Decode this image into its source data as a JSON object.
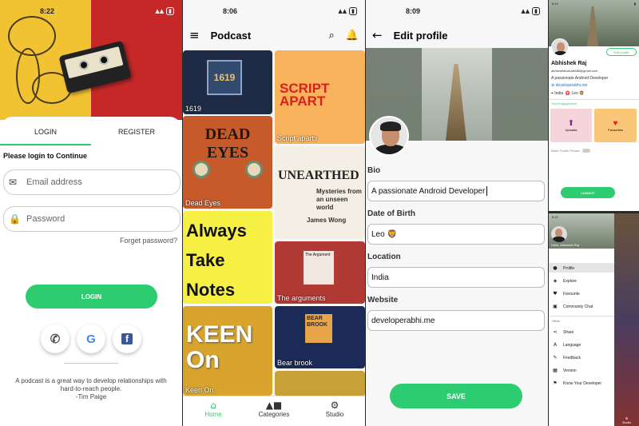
{
  "login": {
    "status_time": "8:22",
    "tab_login": "LOGIN",
    "tab_register": "REGISTER",
    "prompt": "Please login to Continue",
    "email_placeholder": "Email address",
    "password_placeholder": "Password",
    "forgot": "Forget password?",
    "login_button": "LOGIN",
    "quote": "A podcast is a great way to develop relationships with hard-to-reach people.",
    "quote_author": "-Tim Paige",
    "accent": "#2ecc71"
  },
  "podcast": {
    "status_time": "8:06",
    "title": "Podcast",
    "tiles": [
      {
        "caption": "1619",
        "art": "1619"
      },
      {
        "caption": "Script aparts",
        "art": "SCRIPT APART"
      },
      {
        "caption": "Dead Eyes",
        "art": "DEAD EYES"
      },
      {
        "caption": "",
        "art": "UNEARTHED",
        "subtitle": "Mysteries from an unseen world",
        "host": "James Wong"
      },
      {
        "caption": "",
        "art": "Always Take Notes"
      },
      {
        "caption": "The arguments",
        "art": "The Argument"
      },
      {
        "caption": "Keen On",
        "art": "KEEN On"
      },
      {
        "caption": "Bear brook",
        "art": "BEAR BROOK"
      }
    ],
    "nav": [
      {
        "label": "Home",
        "icon": "home-icon"
      },
      {
        "label": "Categories",
        "icon": "categories-icon"
      },
      {
        "label": "Studio",
        "icon": "gear-icon"
      }
    ]
  },
  "edit_profile": {
    "status_time": "8:09",
    "title": "Edit profile",
    "bio_label": "Bio",
    "bio_value": "A passionate Android Developer",
    "dob_label": "Date of Birth",
    "dob_value": "Leo 🦁",
    "location_label": "Location",
    "location_value": "India",
    "website_label": "Website",
    "website_value": "developerabhi.me",
    "save_button": "SAVE"
  },
  "profile": {
    "name": "Abhishek Raj",
    "email": "abhishekthakur8688@gmail.com",
    "bio": "A passionate Android Developer",
    "website": "developerabhi.me",
    "location": "India",
    "sign": "Leo 🦁",
    "edit_button": "Edit profile",
    "engagement": "Your Engagement",
    "card1": "Uploads",
    "card2": "Favourites",
    "private_toggle": "Make Profile Private",
    "logout": "LOGOUT"
  },
  "drawer": {
    "greeting": "Hello, Abhishek Raj",
    "items": [
      "Profile",
      "Explore",
      "Favourite",
      "Community Chat"
    ],
    "other_label": "Other",
    "other_items": [
      "Share",
      "Language",
      "Feedback",
      "Version",
      "Know Your Developer"
    ],
    "studio": "Studio"
  }
}
